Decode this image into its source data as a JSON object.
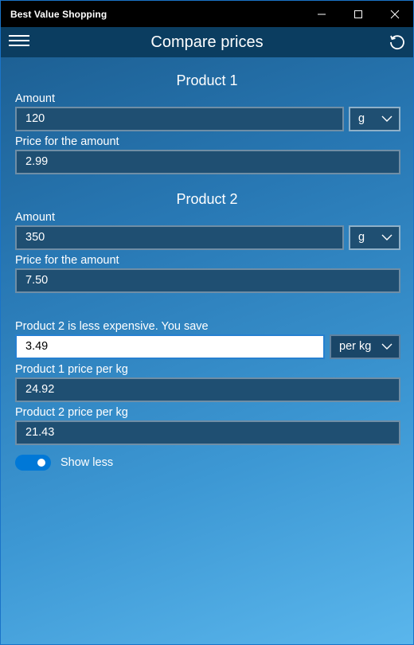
{
  "window": {
    "title": "Best Value Shopping"
  },
  "header": {
    "title": "Compare prices",
    "menu_icon": "hamburger-icon",
    "refresh_icon": "refresh-icon"
  },
  "product1": {
    "title": "Product 1",
    "amount_label": "Amount",
    "amount_value": "120",
    "unit": "g",
    "price_label": "Price for the amount",
    "price_value": "2.99"
  },
  "product2": {
    "title": "Product 2",
    "amount_label": "Amount",
    "amount_value": "350",
    "unit": "g",
    "price_label": "Price for the amount",
    "price_value": "7.50"
  },
  "result": {
    "message": "Product 2 is less expensive. You save",
    "savings_value": "3.49",
    "per_unit": "per kg",
    "p1_label": "Product 1 price per kg",
    "p1_value": "24.92",
    "p2_label": "Product 2 price per kg",
    "p2_value": "21.43"
  },
  "toggle": {
    "label": "Show less",
    "on": true
  },
  "colors": {
    "accent": "#0078d7",
    "header_bg": "#0b3d60",
    "field_bg": "#1f4f72"
  }
}
